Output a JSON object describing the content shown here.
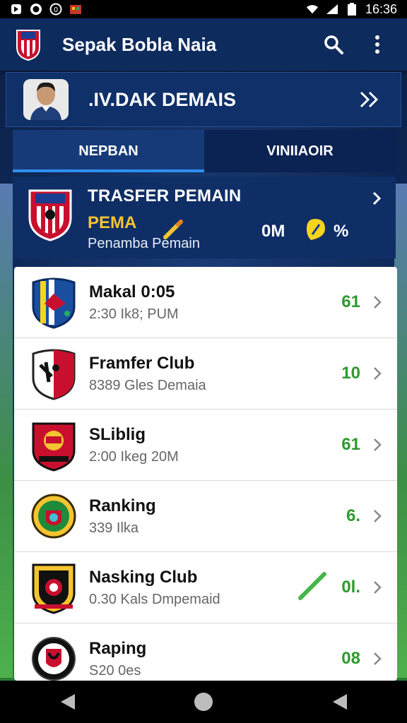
{
  "status_bar": {
    "time": "16:36",
    "left_icons": [
      "notification-icon",
      "whatsapp-icon",
      "record-icon",
      "app-icon"
    ],
    "right_icons": [
      "wifi-icon",
      "signal-icon",
      "battery-icon"
    ]
  },
  "app_bar": {
    "title": "Sepak Bobla Naia",
    "actions": [
      "search-icon",
      "more-vert-icon"
    ]
  },
  "player": {
    "name": ".IV.DAK DEMAIS"
  },
  "tabs": [
    {
      "label": "NEPBAN",
      "active": true
    },
    {
      "label": "VINIIAOIR",
      "active": false
    }
  ],
  "banner": {
    "title": "TRASFER PEMAIN",
    "sub": "PEMA",
    "value": "0M",
    "percent": "%",
    "caption": "Penamba Pemain"
  },
  "list": [
    {
      "title": "Makal 0:05",
      "sub": "2:30 Ik8; PUM",
      "score": "61",
      "mark": false
    },
    {
      "title": "Framfer Club",
      "sub": "8389 Gles Demaia",
      "score": "10",
      "mark": false
    },
    {
      "title": "SLiblig",
      "sub": "2:00 Ikeg 20M",
      "score": "61",
      "mark": false
    },
    {
      "title": "Ranking",
      "sub": "339 Ilka",
      "score": "6.",
      "mark": false
    },
    {
      "title": "Nasking Club",
      "sub": "0.30 Kals Dmpemaid",
      "score": "0l.",
      "mark": true
    },
    {
      "title": "Raping",
      "sub": "S20 0es",
      "score": "08",
      "mark": false
    }
  ],
  "colors": {
    "app_bar": "#0e2b5e",
    "accent_tab": "#2f8ff0",
    "banner_highlight": "#f4c430",
    "score_green": "#2e9a2e"
  },
  "nav": [
    "back-icon",
    "home-icon",
    "recents-icon"
  ]
}
